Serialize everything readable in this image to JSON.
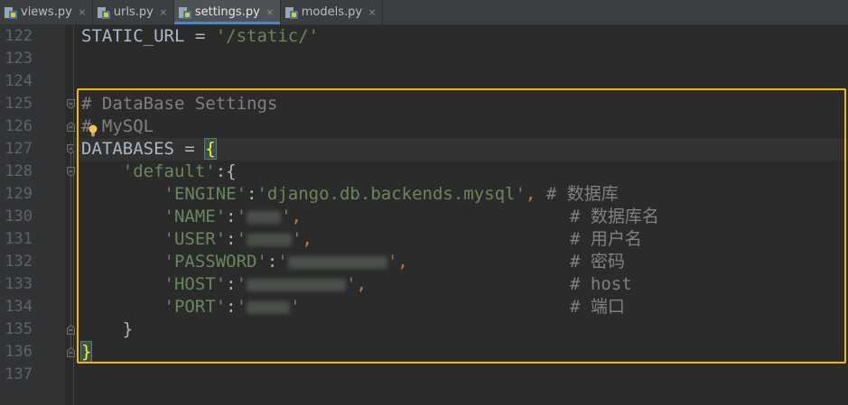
{
  "tabs": [
    {
      "label": "views.py",
      "active": false
    },
    {
      "label": "urls.py",
      "active": false
    },
    {
      "label": "settings.py",
      "active": true
    },
    {
      "label": "models.py",
      "active": false
    }
  ],
  "tab_close_glyph": "×",
  "line_numbers": [
    "122",
    "123",
    "124",
    "125",
    "126",
    "127",
    "128",
    "129",
    "130",
    "131",
    "132",
    "133",
    "134",
    "135",
    "136",
    "137"
  ],
  "code": {
    "l122": {
      "var": "STATIC_URL",
      "op": " = ",
      "str": "'/static/'"
    },
    "l125": {
      "comment": "# DataBase Settings"
    },
    "l126": {
      "comment_hash": "#",
      "comment_rest": " MySQL"
    },
    "l127": {
      "var": "DATABASES",
      "op": " = ",
      "brace": "{"
    },
    "l128": {
      "indent": "    ",
      "key": "'default'",
      "rest": ":{"
    },
    "l129": {
      "indent": "        ",
      "key": "'ENGINE'",
      "colon": ":",
      "value": "'django.db.backends.mysql'",
      "comma": ",",
      "gap": " ",
      "comment": "# 数据库"
    },
    "l130": {
      "indent": "        ",
      "key": "'NAME'",
      "colon": ":",
      "open": "'",
      "close": "'",
      "comma": ",",
      "comment": "# 数据库名"
    },
    "l131": {
      "indent": "        ",
      "key": "'USER'",
      "colon": ":",
      "open": "'",
      "close": "'",
      "comma": ",",
      "comment": "# 用户名"
    },
    "l132": {
      "indent": "        ",
      "key": "'PASSWORD'",
      "colon": ":",
      "open": "'",
      "close": "'",
      "comma": ",",
      "comment": "# 密码"
    },
    "l133": {
      "indent": "        ",
      "key": "'HOST'",
      "colon": ":",
      "open": "'",
      "close": "'",
      "comma": ",",
      "comment": "# host"
    },
    "l134": {
      "indent": "        ",
      "key": "'PORT'",
      "colon": ":",
      "open": "'",
      "close": "'",
      "comment": "# 端口"
    },
    "l135": {
      "indent": "    ",
      "brace": "}"
    },
    "l136": {
      "brace": "}"
    }
  },
  "colors": {
    "editor_bg": "#2b2b2b",
    "string": "#6a8759",
    "comment": "#808080",
    "keyword_punct": "#cc7832",
    "identifier": "#a9b7c6",
    "highlight_border": "#f5b800"
  },
  "icons": {
    "file": "python-file-icon",
    "intention": "lightbulb-icon",
    "fold": "fold-marker-icon"
  }
}
